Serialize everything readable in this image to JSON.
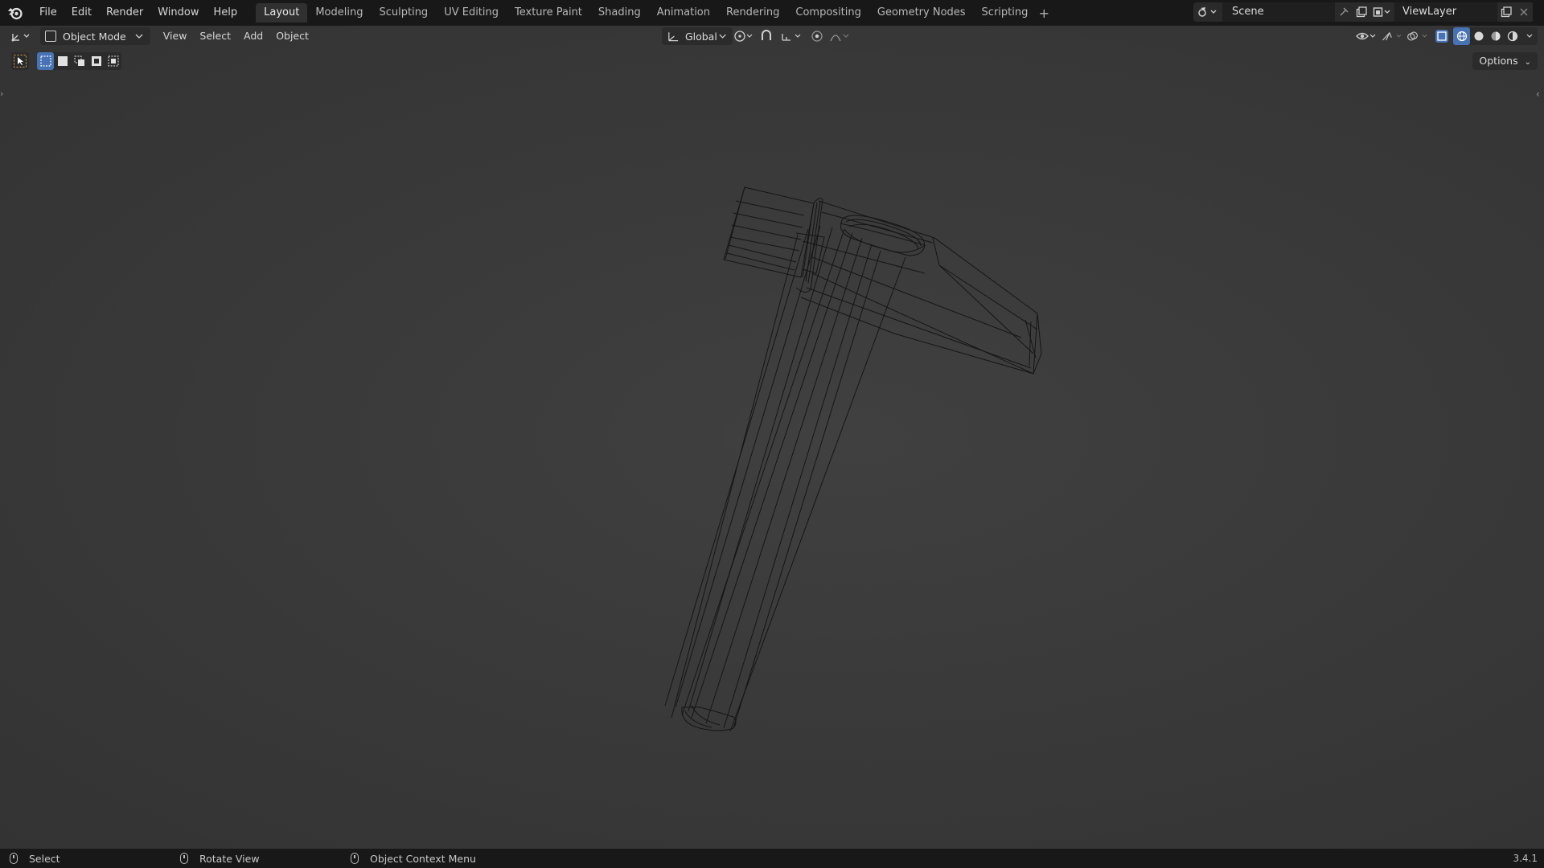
{
  "topbar": {
    "menu": [
      "File",
      "Edit",
      "Render",
      "Window",
      "Help"
    ],
    "workspaces": [
      "Layout",
      "Modeling",
      "Sculpting",
      "UV Editing",
      "Texture Paint",
      "Shading",
      "Animation",
      "Rendering",
      "Compositing",
      "Geometry Nodes",
      "Scripting"
    ],
    "active_workspace": "Layout",
    "scene": "Scene",
    "view_layer": "ViewLayer"
  },
  "viewport_header": {
    "mode": "Object Mode",
    "menu": [
      "View",
      "Select",
      "Add",
      "Object"
    ],
    "transform_orientation": "Global",
    "options_label": "Options"
  },
  "statusbar": {
    "left": "Select",
    "middle": "Rotate View",
    "right": "Object Context Menu",
    "version": "3.4.1"
  },
  "colors": {
    "accent": "#4772b3",
    "viewport_bg": "#3b3b3b",
    "bar_bg": "#181818",
    "wire": "#111111"
  }
}
